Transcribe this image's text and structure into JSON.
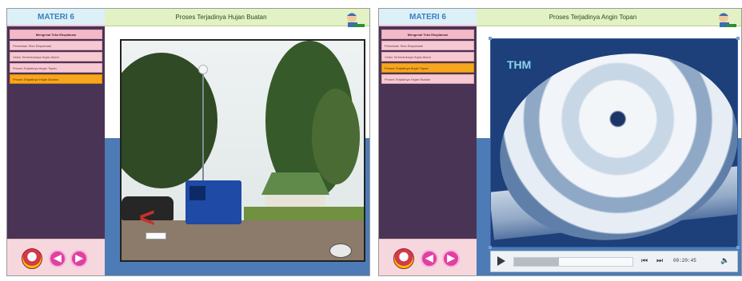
{
  "panels": [
    {
      "sidebar_title": "MATERI 6",
      "page_title": "Proses Terjadinya Hujan Buatan",
      "menu": [
        {
          "label": "Mengenal Teks Eksplanasi",
          "state": "heading"
        },
        {
          "label": "Pemetaan Teks Eksplanasi",
          "state": "normal"
        },
        {
          "label": "Video Terbentuknya Hujan Alami",
          "state": "normal"
        },
        {
          "label": "Proses Terjadinya Angin Topan",
          "state": "normal"
        },
        {
          "label": "Proses Terjadinya Hujan Buatan",
          "state": "active"
        }
      ]
    },
    {
      "sidebar_title": "MATERI 6",
      "page_title": "Proses Terjadinya Angin Topan",
      "menu": [
        {
          "label": "Mengenal Teks Eksplanasi",
          "state": "heading"
        },
        {
          "label": "Pemetaan Teks Eksplanasi",
          "state": "normal"
        },
        {
          "label": "Video Terbentuknya Hujan Alami",
          "state": "normal"
        },
        {
          "label": "Proses Terjadinya Angin Topan",
          "state": "active"
        },
        {
          "label": "Proses Terjadinya Hujan Buatan",
          "state": "normal"
        }
      ],
      "video": {
        "channel_logo": "ТНМ",
        "time": "00:20:45",
        "progress": 0.38
      }
    }
  ],
  "colors": {
    "sidebar": "#4a3456",
    "menu_item": "#f6c9d3",
    "menu_active": "#f6a71f",
    "topbar": "#e3f2c5",
    "content_blue": "#4d7bb5",
    "nav_button": "#e040a0"
  },
  "icons": {
    "nav_prev": "◀",
    "nav_next": "▶",
    "play": "play-icon",
    "skip_back": "⏮",
    "skip_forward": "⏭",
    "volume": "🔈"
  }
}
